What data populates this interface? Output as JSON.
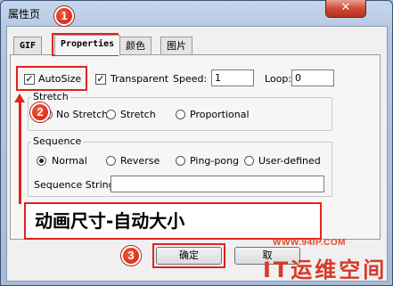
{
  "window": {
    "title": "属性页",
    "close_label": "✕"
  },
  "tabs": [
    {
      "label": "GIF"
    },
    {
      "label": "Properties"
    },
    {
      "label": "颜色"
    },
    {
      "label": "图片"
    }
  ],
  "options": {
    "autosize": {
      "label": "AutoSize",
      "checked": true
    },
    "transparent": {
      "label": "Transparent",
      "checked": true
    },
    "speed": {
      "label": "Speed:",
      "value": "1"
    },
    "loop": {
      "label": "Loop:",
      "value": "0"
    }
  },
  "stretch": {
    "title": "Stretch",
    "options": [
      {
        "label": "No Stretch",
        "selected": false
      },
      {
        "label": "Stretch",
        "selected": false
      },
      {
        "label": "Proportional",
        "selected": false
      }
    ]
  },
  "sequence": {
    "title": "Sequence",
    "options": [
      {
        "label": "Normal",
        "selected": true
      },
      {
        "label": "Reverse",
        "selected": false
      },
      {
        "label": "Ping-pong",
        "selected": false
      },
      {
        "label": "User-defined",
        "selected": false
      }
    ],
    "string_label": "Sequence String:",
    "string_value": ""
  },
  "buttons": {
    "ok": "确定",
    "cancel": "取"
  },
  "annotations": {
    "markers": [
      "1",
      "2",
      "3"
    ],
    "caption": "动画尺寸-自动大小",
    "accent": "#e0231d"
  },
  "watermark": {
    "url": "WWW.94IP.COM",
    "brand": "IT运维空间"
  }
}
